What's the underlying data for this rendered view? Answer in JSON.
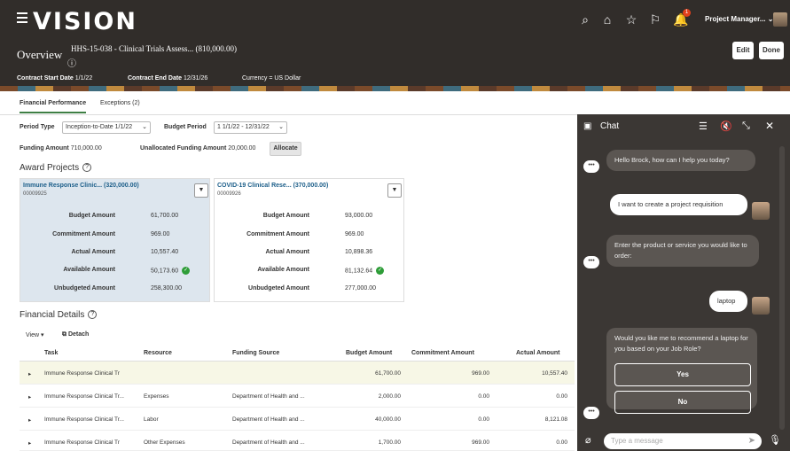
{
  "app": {
    "logo": "VISION",
    "user_label": "Project Manager...",
    "notif_count": "1"
  },
  "header": {
    "title": "Overview",
    "subtitle": "HHS-15-038 - Clinical Trials Assess... (810,000.00)",
    "edit": "Edit",
    "done": "Done",
    "contract_start_label": "Contract Start Date",
    "contract_start": "1/1/22",
    "contract_end_label": "Contract End Date",
    "contract_end": "12/31/26",
    "currency": "Currency = US Dollar"
  },
  "tabs": [
    "Financial Performance",
    "Exceptions (2)"
  ],
  "filters": {
    "period_type_label": "Period Type",
    "period_type": "Inception-to-Date 1/1/22",
    "budget_period_label": "Budget Period",
    "budget_period": "1 1/1/22 - 12/31/22",
    "funding_amount_label": "Funding Amount",
    "funding_amount": "710,000.00",
    "unallocated_label": "Unallocated Funding Amount",
    "unallocated": "20,000.00",
    "allocate": "Allocate"
  },
  "award_projects": {
    "title": "Award Projects",
    "cards": [
      {
        "title": "Immune Response Clinic... (320,000.00)",
        "number": "00009925",
        "rows": [
          [
            "Budget Amount",
            "61,700.00"
          ],
          [
            "Commitment Amount",
            "969.00"
          ],
          [
            "Actual Amount",
            "10,557.40"
          ],
          [
            "Available Amount",
            "50,173.60"
          ],
          [
            "Unbudgeted Amount",
            "258,300.00"
          ]
        ]
      },
      {
        "title": "COVID-19 Clinical Rese... (370,000.00)",
        "number": "00009926",
        "rows": [
          [
            "Budget Amount",
            "93,000.00"
          ],
          [
            "Commitment Amount",
            "969.00"
          ],
          [
            "Actual Amount",
            "10,898.36"
          ],
          [
            "Available Amount",
            "81,132.64"
          ],
          [
            "Unbudgeted Amount",
            "277,000.00"
          ]
        ]
      }
    ]
  },
  "financial_details": {
    "title": "Financial Details",
    "view": "View",
    "detach": "Detach",
    "columns": [
      "Task",
      "Resource",
      "Funding Source",
      "Budget Amount",
      "Commitment Amount",
      "Actual Amount"
    ],
    "rows": [
      [
        "Immune Response Clinical Tr",
        "",
        "",
        "61,700.00",
        "969.00",
        "10,557.40"
      ],
      [
        "Immune Response Clinical Tr...",
        "Expenses",
        "Department of Health and ...",
        "2,000.00",
        "0.00",
        "0.00"
      ],
      [
        "Immune Response Clinical Tr...",
        "Labor",
        "Department of Health and ...",
        "40,000.00",
        "0.00",
        "8,121.08"
      ],
      [
        "Immune Response Clinical Tr",
        "Other Expenses",
        "Department of Health and ...",
        "1,700.00",
        "969.00",
        "0.00"
      ]
    ]
  },
  "chat": {
    "title": "Chat",
    "m1": "Hello Brock, how can I help you today?",
    "u1": "I want to create a project requisition",
    "m2": "Enter the product or service you would like to order:",
    "u2": "laptop",
    "m3": "Would you like me to recommend a laptop for you based on your Job Role?",
    "yes": "Yes",
    "no": "No",
    "placeholder": "Type a message"
  }
}
